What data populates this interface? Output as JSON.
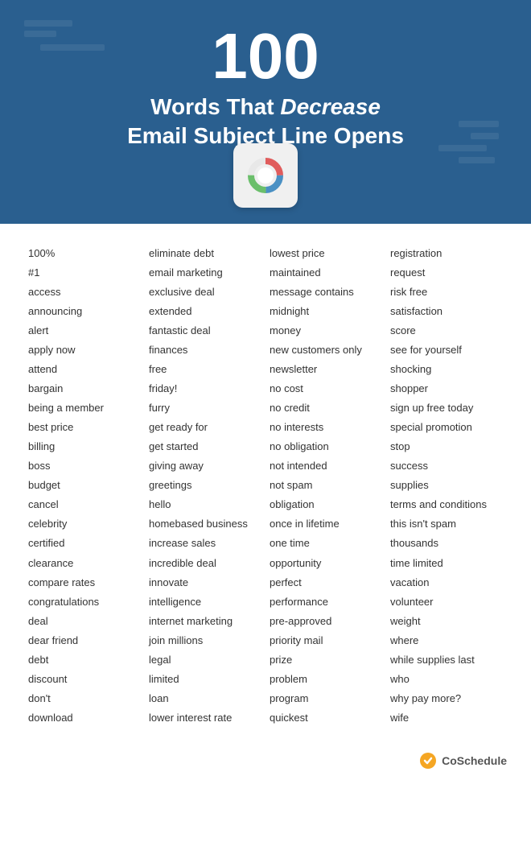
{
  "header": {
    "number": "100",
    "line1": "Words That ",
    "line1_italic": "Decrease",
    "line2": "Email Subject Line Opens"
  },
  "columns": [
    {
      "words": [
        "100%",
        "#1",
        "access",
        "announcing",
        "alert",
        "apply now",
        "attend",
        "bargain",
        "being a member",
        "best price",
        "billing",
        "boss",
        "budget",
        "cancel",
        "celebrity",
        "certified",
        "clearance",
        "compare rates",
        "congratulations",
        "deal",
        "dear friend",
        "debt",
        "discount",
        "don't",
        "download"
      ]
    },
    {
      "words": [
        "eliminate debt",
        "email marketing",
        "exclusive deal",
        "extended",
        "fantastic deal",
        "finances",
        "free",
        "friday!",
        "furry",
        "get ready for",
        "get started",
        "giving away",
        "greetings",
        "hello",
        "homebased business",
        "increase sales",
        "incredible deal",
        "innovate",
        "intelligence",
        "internet marketing",
        "join millions",
        "legal",
        "limited",
        "loan",
        "lower interest rate"
      ]
    },
    {
      "words": [
        "lowest price",
        "maintained",
        "message contains",
        "midnight",
        "money",
        "new customers only",
        "newsletter",
        "no cost",
        "no credit",
        "no interests",
        "no obligation",
        "not intended",
        "not spam",
        "obligation",
        "once in lifetime",
        "one time",
        "opportunity",
        "perfect",
        "performance",
        "pre-approved",
        "priority mail",
        "prize",
        "problem",
        "program",
        "quickest"
      ]
    },
    {
      "words": [
        "registration",
        "request",
        "risk free",
        "satisfaction",
        "score",
        "see for yourself",
        "shocking",
        "shopper",
        "sign up free today",
        "special promotion",
        "stop",
        "success",
        "supplies",
        "terms and conditions",
        "this isn't spam",
        "thousands",
        "time limited",
        "vacation",
        "volunteer",
        "weight",
        "where",
        "while supplies last",
        "who",
        "why pay more?",
        "wife"
      ]
    }
  ],
  "brand": {
    "name": "CoSchedule"
  }
}
